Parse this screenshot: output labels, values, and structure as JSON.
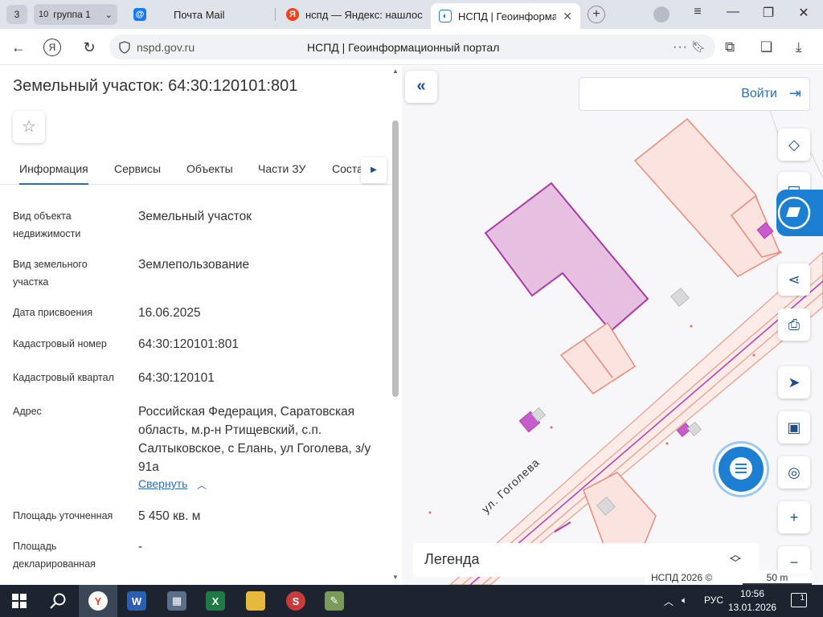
{
  "browser": {
    "tab_count": "3",
    "group": {
      "count": "10",
      "label": "группа 1"
    },
    "tabs": [
      {
        "label": "Почта Mail",
        "favicon": "mail-icon"
      },
      {
        "label": "нспд — Яндекс: нашлось",
        "favicon": "yandex-icon"
      },
      {
        "label": "НСПД | Геоинформацио",
        "favicon": "nspd-icon"
      }
    ],
    "url": "nspd.gov.ru",
    "page_title": "НСПД | Геоинформационный портал"
  },
  "panel": {
    "title": "Земельный участок: 64:30:120101:801",
    "tabs": [
      "Информация",
      "Сервисы",
      "Объекты",
      "Части ЗУ",
      "Состав"
    ],
    "rows": [
      {
        "label": "Вид объекта недвижимости",
        "value": "Земельный участок"
      },
      {
        "label": "Вид земельного участка",
        "value": "Землепользование"
      },
      {
        "label": "Дата присвоения",
        "value": "16.06.2025"
      },
      {
        "label": "Кадастровый номер",
        "value": "64:30:120101:801"
      },
      {
        "label": "Кадастровый квартал",
        "value": "64:30:120101"
      },
      {
        "label": "Адрес",
        "value": "Российская Федерация, Саратовская область, м.р-н Ртищевский, с.п. Салтыковское, с Елань, ул Гоголева, з/у 91а"
      },
      {
        "label": "Площадь уточненная",
        "value": "5 450 кв. м"
      },
      {
        "label": "Площадь декларированная",
        "value": "-"
      }
    ],
    "collapse_label": "Свернуть"
  },
  "map": {
    "login_label": "Войти",
    "legend_label": "Легенда",
    "copyright": "НСПД 2026 ©",
    "scale": "50 m",
    "street": "ул. Гоголева",
    "colors": {
      "parcel_selected": "#e7bfe0",
      "parcel_selected_stroke": "#a83aa8",
      "parcel": "#fbe4df",
      "parcel_stroke": "#ea8a78",
      "accent": "#1d7fd1"
    }
  },
  "taskbar": {
    "lang": "РУС",
    "time": "10:56",
    "date": "13.01.2026",
    "notifications": "1"
  }
}
